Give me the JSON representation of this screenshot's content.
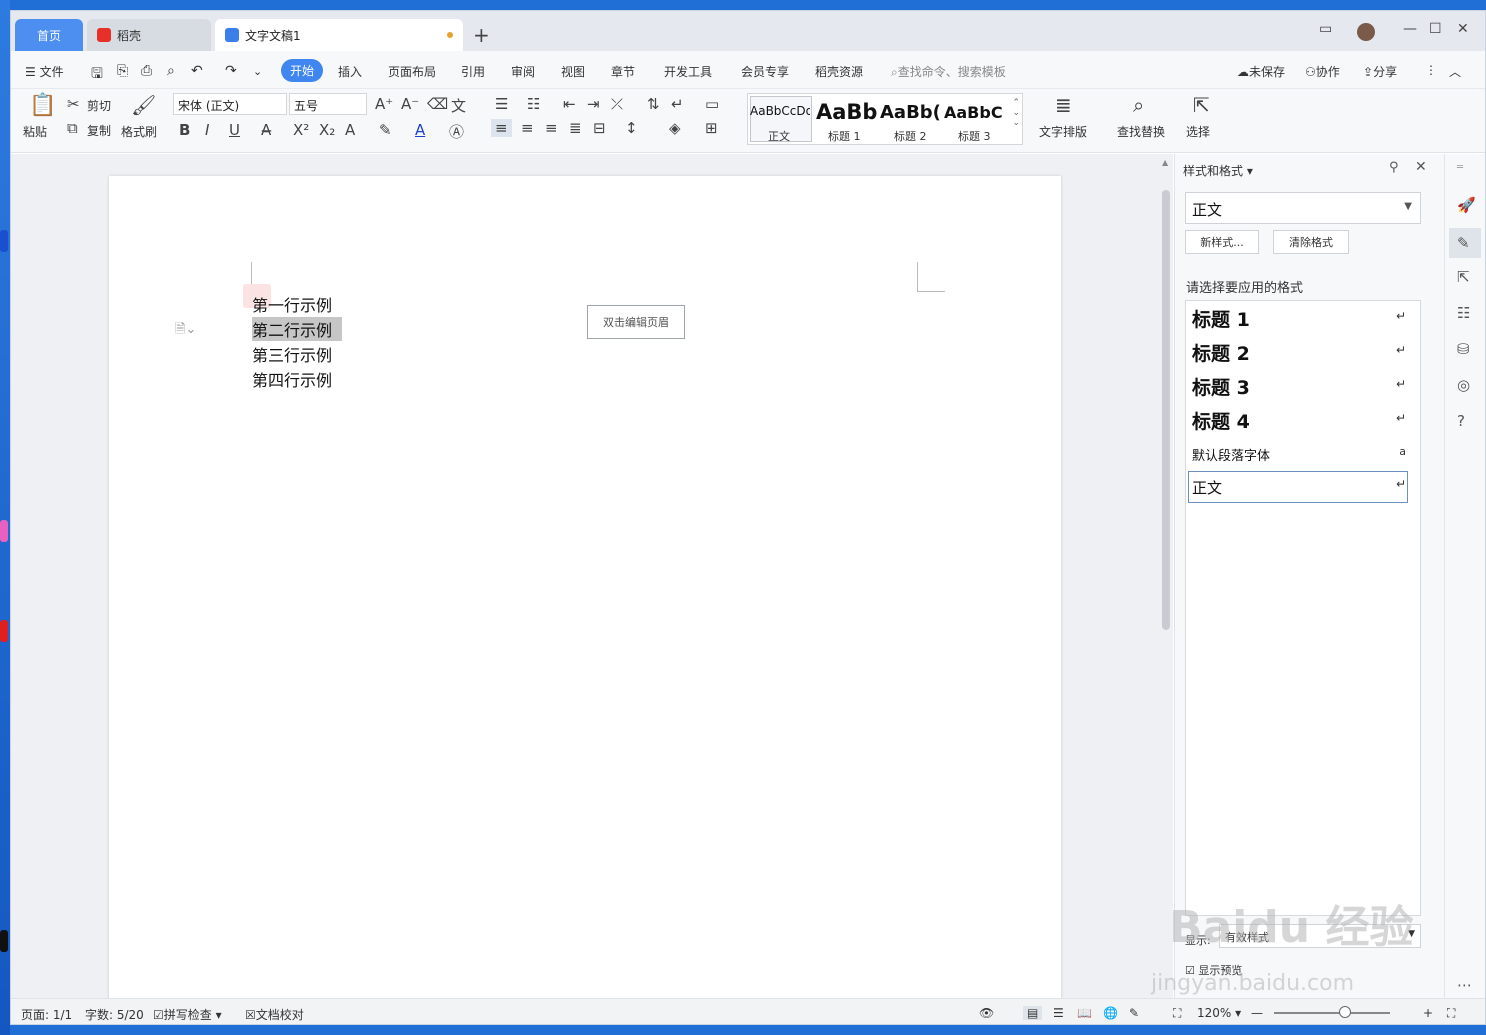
{
  "tabs": {
    "home": "首页",
    "daoke": "稻壳",
    "doc": "文字文稿1"
  },
  "menu": {
    "file": "文件",
    "items": [
      "开始",
      "插入",
      "页面布局",
      "引用",
      "审阅",
      "视图",
      "章节",
      "开发工具",
      "会员专享",
      "稻壳资源"
    ],
    "search_placeholder": "查找命令、搜索模板",
    "unsaved": "未保存",
    "collab": "协作",
    "share": "分享"
  },
  "ribbon": {
    "paste": "粘贴",
    "cut": "剪切",
    "copy": "复制",
    "format_painter": "格式刷",
    "font_name": "宋体 (正文)",
    "font_size": "五号",
    "styles": [
      {
        "preview": "AaBbCcDd",
        "caption": "正文"
      },
      {
        "preview": "AaBb",
        "caption": "标题 1"
      },
      {
        "preview": "AaBb(",
        "caption": "标题 2"
      },
      {
        "preview": "AaBbC",
        "caption": "标题 3"
      }
    ],
    "text_layout": "文字排版",
    "find_replace": "查找替换",
    "select": "选择"
  },
  "document": {
    "lines": [
      "第一行示例",
      "第二行示例",
      "第三行示例",
      "第四行示例"
    ],
    "header_hint": "双击编辑页眉"
  },
  "panel": {
    "title": "样式和格式",
    "current_style": "正文",
    "new_style": "新样式...",
    "clear_format": "清除格式",
    "apply_label": "请选择要应用的格式",
    "styles": [
      "标题 1",
      "标题 2",
      "标题 3",
      "标题 4",
      "默认段落字体",
      "正文"
    ],
    "show_label": "显示:",
    "show_value": "有效样式",
    "preview_label": "显示预览"
  },
  "status": {
    "page": "页面: 1/1",
    "words": "字数: 5/20",
    "spell": "拼写检查",
    "proof": "文档校对",
    "zoom": "120%"
  },
  "watermark": {
    "main": "Baidu 经验",
    "url": "jingyan.baidu.com"
  }
}
